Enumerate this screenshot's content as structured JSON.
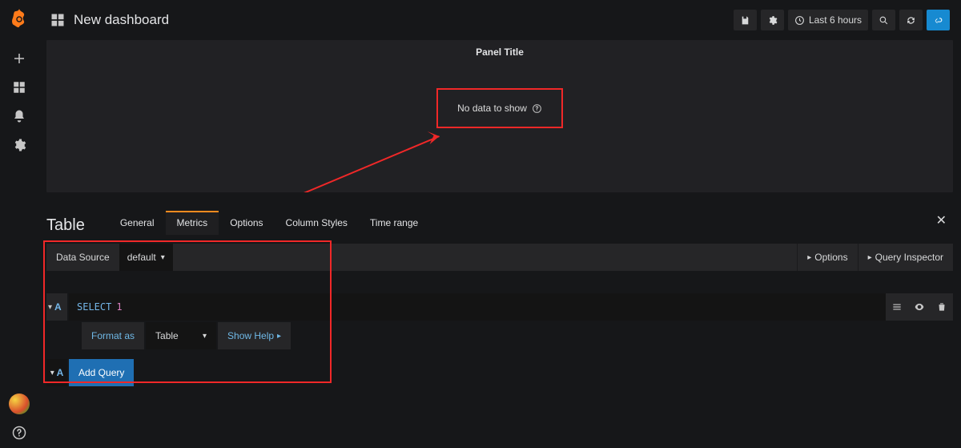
{
  "header": {
    "title": "New dashboard",
    "time_range_label": "Last 6 hours"
  },
  "panel": {
    "title": "Panel Title",
    "no_data_message": "No data to show"
  },
  "editor": {
    "panel_type": "Table",
    "tabs": [
      "General",
      "Metrics",
      "Options",
      "Column Styles",
      "Time range"
    ],
    "active_tab_index": 1,
    "close_glyph": "✕"
  },
  "datasource": {
    "label": "Data Source",
    "selected": "default",
    "options_btn": "Options",
    "inspector_btn": "Query Inspector"
  },
  "query": {
    "letter": "A",
    "text_keyword": "SELECT",
    "text_literal": "1",
    "format_label": "Format as",
    "format_value": "Table",
    "help_label": "Show Help"
  },
  "add": {
    "letter": "A",
    "button_label": "Add Query"
  }
}
